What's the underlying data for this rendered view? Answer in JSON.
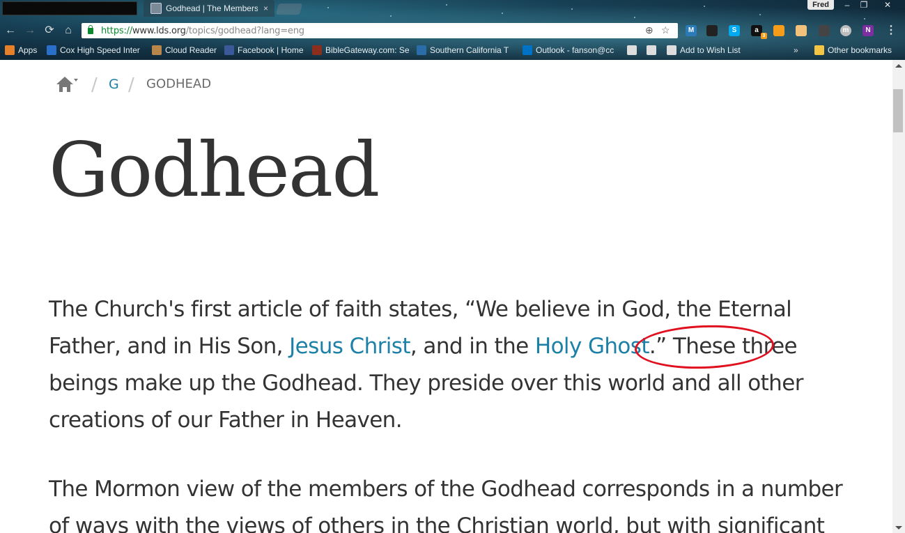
{
  "browser": {
    "tab": {
      "title": "Godhead | The Members",
      "close": "×"
    },
    "user_badge": "Fred",
    "window_controls": {
      "minimize": "–",
      "restore": "❐",
      "close": "✕"
    },
    "nav": {
      "back": "←",
      "forward": "→",
      "reload": "⟳",
      "home": "⌂"
    },
    "address": {
      "scheme": "https://",
      "host": "www.lds.org",
      "path": "/topics/godhead?lang=eng"
    },
    "omnibox_icons": [
      "zoom-icon",
      "bookmark-star-icon"
    ],
    "extensions": [
      {
        "name": "mcafee-icon",
        "label": "M",
        "color": "#2b7bb9"
      },
      {
        "name": "clock-icon",
        "label": "",
        "color": "#222222"
      },
      {
        "name": "skype-icon",
        "label": "S",
        "color": "#00a9f0"
      },
      {
        "name": "amazon-assistant-icon",
        "label": "a",
        "color": "#111111"
      },
      {
        "name": "amazon-smile-icon",
        "label": "",
        "color": "#f59c1a"
      },
      {
        "name": "ghostery-icon",
        "label": "",
        "color": "#f2c27d"
      },
      {
        "name": "printer-icon",
        "label": "",
        "color": "#444444"
      },
      {
        "name": "profile-icon",
        "label": "m",
        "color": "#bdbdbd"
      },
      {
        "name": "onenote-icon",
        "label": "N",
        "color": "#7b2fa0"
      }
    ],
    "menu": "⋮",
    "amazon_badge": "3",
    "bookmarks": [
      {
        "name": "bookmark-apps",
        "label": "Apps",
        "icon_color": "#e8802a"
      },
      {
        "name": "bookmark-cox",
        "label": "Cox High Speed Inter",
        "icon_color": "#2a6fc9"
      },
      {
        "name": "bookmark-cloud-reader",
        "label": "Cloud Reader",
        "icon_color": "#b8864a"
      },
      {
        "name": "bookmark-facebook",
        "label": "Facebook | Home",
        "icon_color": "#3b5998"
      },
      {
        "name": "bookmark-biblegateway",
        "label": "BibleGateway.com: Se",
        "icon_color": "#8b2e1e"
      },
      {
        "name": "bookmark-southern-california",
        "label": "Southern California T",
        "icon_color": "#2b6da8"
      },
      {
        "name": "bookmark-outlook",
        "label": "Outlook - fanson@cc",
        "icon_color": "#0072c6"
      },
      {
        "name": "bookmark-blank-1",
        "label": "",
        "icon_color": "#dddddd"
      },
      {
        "name": "bookmark-blank-2",
        "label": "",
        "icon_color": "#dddddd"
      },
      {
        "name": "bookmark-add-to-wish-list",
        "label": "Add to Wish List",
        "icon_color": "#dddddd"
      }
    ],
    "overflow": "»",
    "other_bookmarks": "Other bookmarks"
  },
  "page": {
    "breadcrumb": {
      "home_label": "home",
      "letter": "G",
      "current": "GODHEAD"
    },
    "title": "Godhead",
    "p1": {
      "t1": "The Church's first article of faith states, “We believe in God, the Eternal Father, and in His Son, ",
      "link1": "Jesus Christ",
      "t2": ", and in the ",
      "link2": "Holy Ghost",
      "t3": ".” These ",
      "highlight": "three beings",
      "t4": " make up the Godhead. They preside over this world and all other creations of our Father in Heaven."
    },
    "p2": "The Mormon view of the members of the Godhead corresponds in a number of ways with the views of others in the Christian world, but with significant",
    "annotation_color": "#e0101f",
    "link_color": "#1d80a7"
  }
}
